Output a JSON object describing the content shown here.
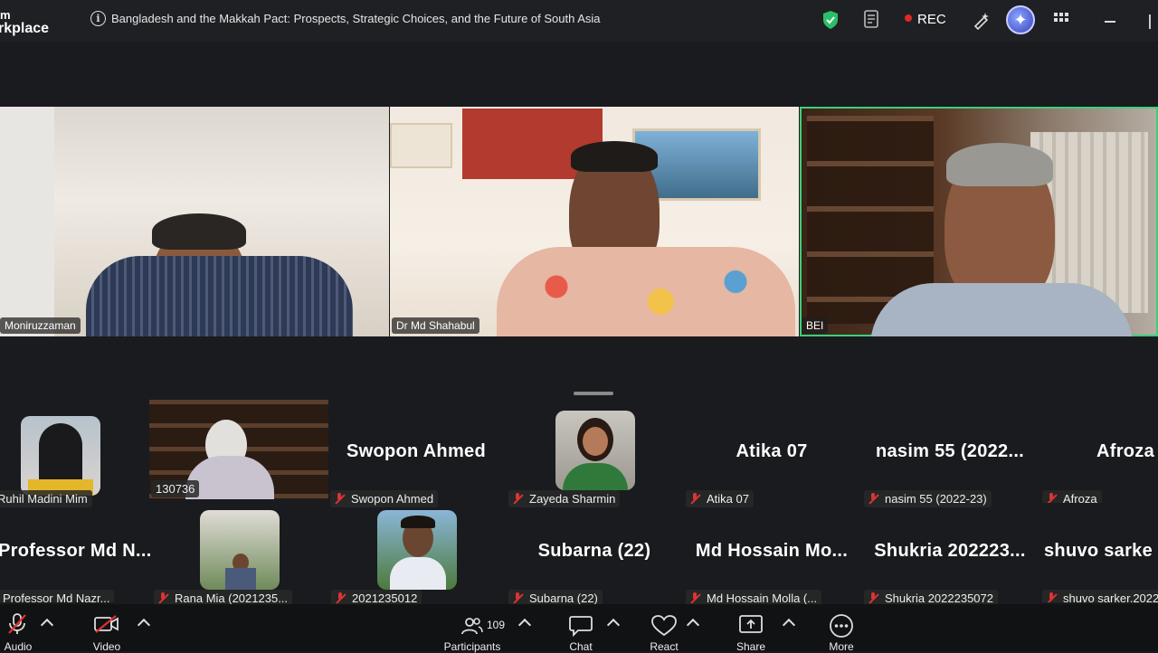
{
  "app": {
    "brand_line1": "m",
    "brand_line2": "rkplace"
  },
  "meeting": {
    "title": "Bangladesh and the Makkah Pact: Prospects, Strategic Choices, and the Future of South Asia"
  },
  "status": {
    "rec_label": "REC"
  },
  "colors": {
    "background": "#1a1b1f",
    "active_speaker": "#3ccf7a",
    "muted_red": "#dd3333",
    "shield_green": "#2bbf6a"
  },
  "video_tiles": [
    {
      "name": "Moniruzzaman"
    },
    {
      "name": "Dr Md Shahabul"
    },
    {
      "name": "BEI"
    }
  ],
  "gallery": {
    "row1": [
      {
        "label": "Ruhil Madini Mim",
        "big_name": "",
        "muted": false
      },
      {
        "label": "130736",
        "big_name": "",
        "muted": false
      },
      {
        "label": "Swopon Ahmed",
        "big_name": "Swopon Ahmed",
        "muted": true
      },
      {
        "label": "Zayeda Sharmin",
        "big_name": "",
        "muted": true
      },
      {
        "label": "Atika 07",
        "big_name": "Atika 07",
        "muted": true
      },
      {
        "label": "nasim 55 (2022-23)",
        "big_name": "nasim 55 (2022...",
        "muted": true
      },
      {
        "label": "Afroza",
        "big_name": "Afroza",
        "muted": true
      }
    ],
    "row2": [
      {
        "label": "Professor Md Nazr...",
        "big_name": "Professor Md N...",
        "muted": false
      },
      {
        "label": "Rana Mia (2021235...",
        "big_name": "",
        "muted": true
      },
      {
        "label": "2021235012",
        "big_name": "",
        "muted": true
      },
      {
        "label": "Subarna (22)",
        "big_name": "Subarna (22)",
        "muted": true
      },
      {
        "label": "Md Hossain Molla (...",
        "big_name": "Md Hossain Mo...",
        "muted": true
      },
      {
        "label": "Shukria 2022235072",
        "big_name": "Shukria 202223...",
        "muted": true
      },
      {
        "label": "shuvo sarker,2022",
        "big_name": "shuvo sarke",
        "muted": true
      }
    ]
  },
  "toolbar": {
    "audio_label": "Audio",
    "video_label": "Video",
    "participants_label": "Participants",
    "participants_count": "109",
    "chat_label": "Chat",
    "react_label": "React",
    "share_label": "Share",
    "more_label": "More"
  }
}
